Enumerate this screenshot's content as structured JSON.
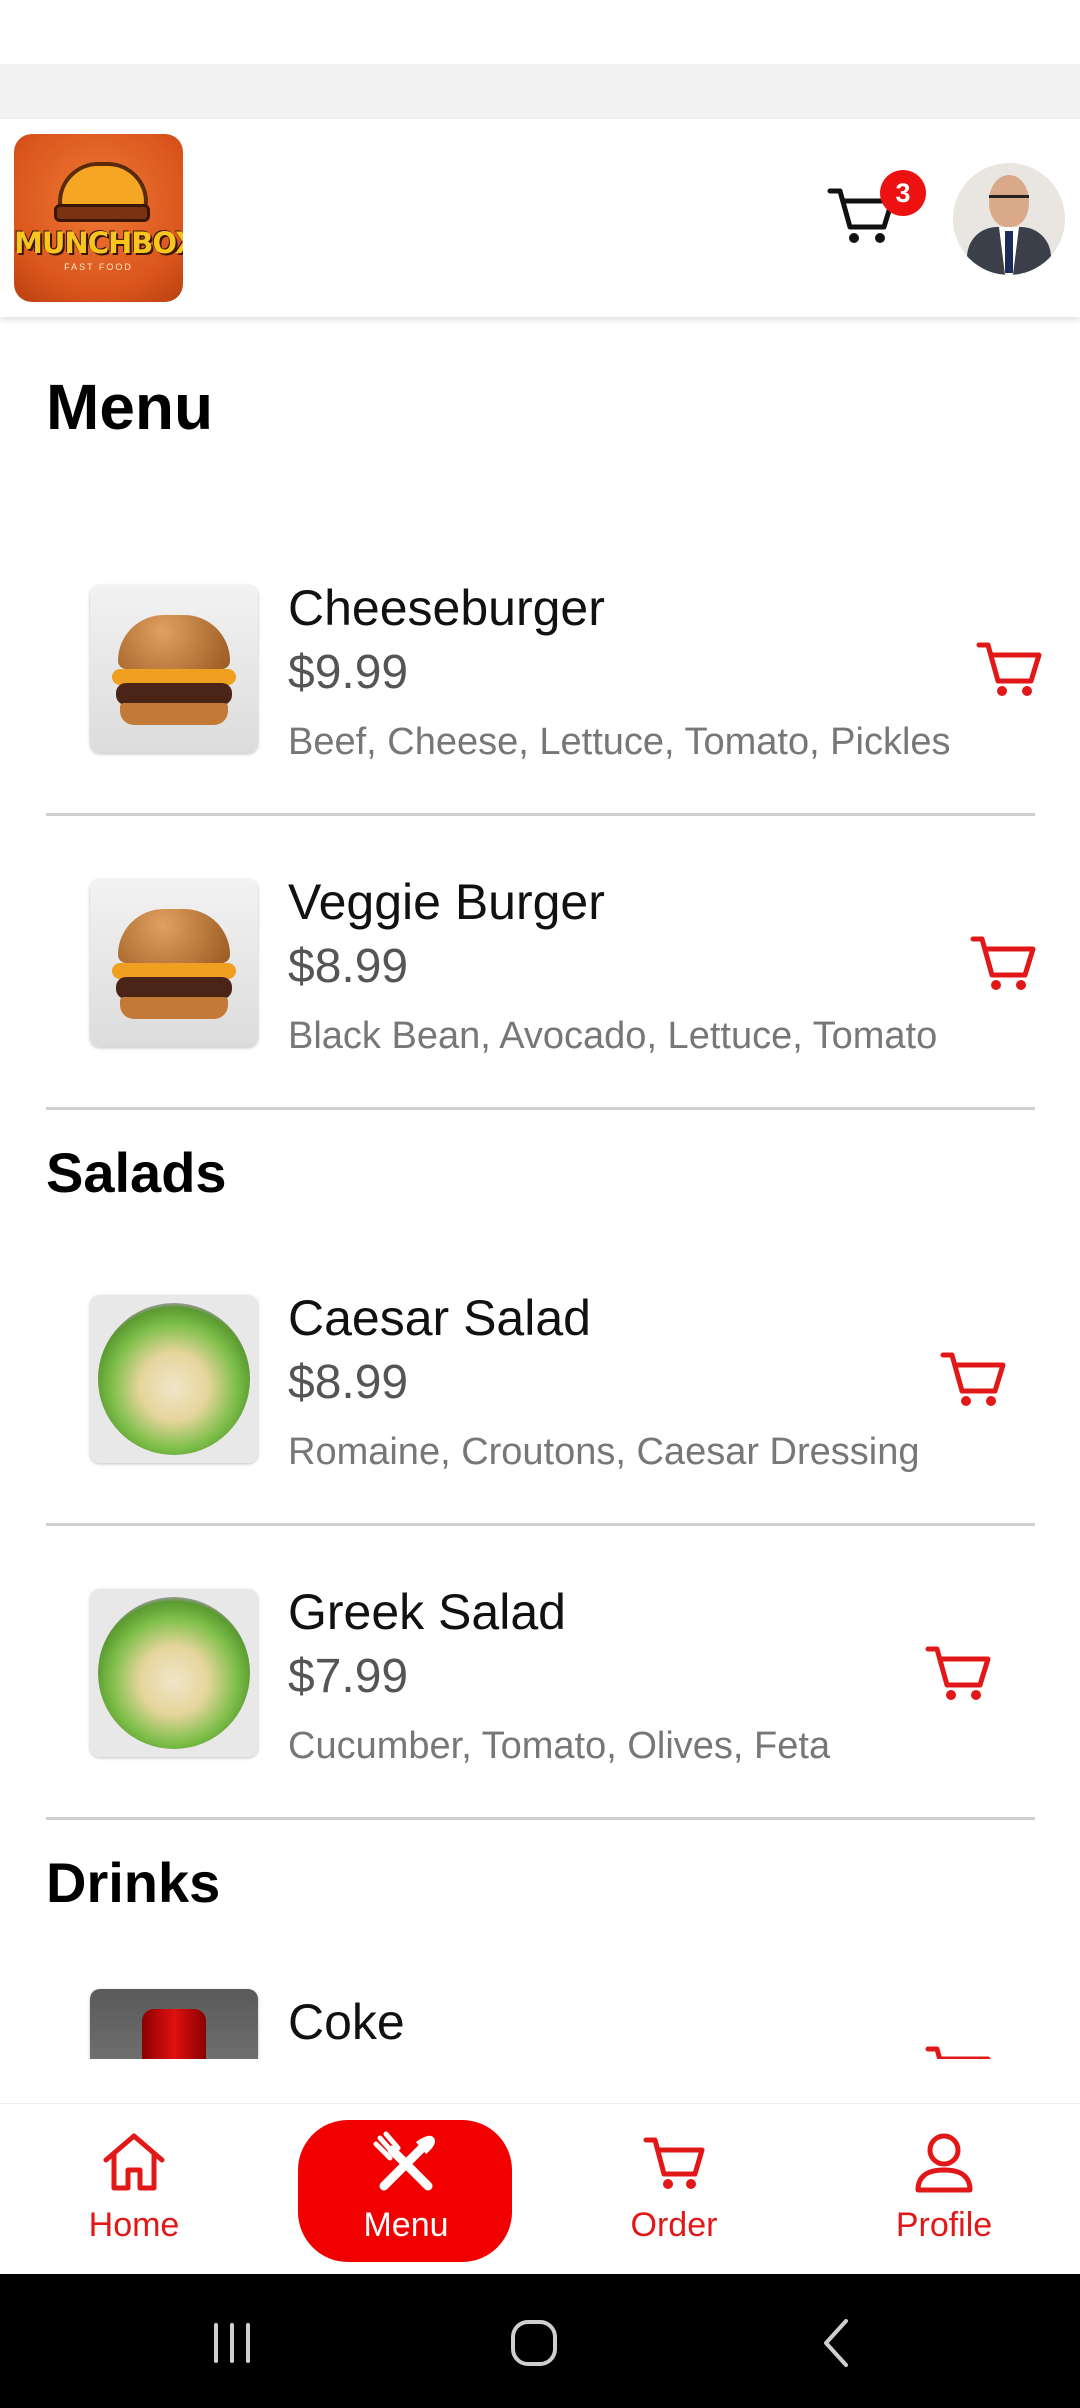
{
  "header": {
    "logo_text": "MUNCHBOX",
    "logo_subtext": "FAST FOOD",
    "cart_count": "3"
  },
  "page_title": "Menu",
  "sections": [
    {
      "title": "",
      "items": [
        {
          "name": "Cheeseburger",
          "price": "$9.99",
          "description": "Beef, Cheese, Lettuce, Tomato, Pickles",
          "image": "burger"
        },
        {
          "name": "Veggie Burger",
          "price": "$8.99",
          "description": "Black Bean, Avocado, Lettuce, Tomato",
          "image": "burger"
        }
      ]
    },
    {
      "title": "Salads",
      "items": [
        {
          "name": "Caesar Salad",
          "price": "$8.99",
          "description": "Romaine, Croutons, Caesar Dressing",
          "image": "salad"
        },
        {
          "name": "Greek Salad",
          "price": "$7.99",
          "description": "Cucumber, Tomato, Olives, Feta",
          "image": "salad"
        }
      ]
    },
    {
      "title": "Drinks",
      "items": [
        {
          "name": "Coke",
          "price": "",
          "description": "",
          "image": "coke"
        }
      ]
    }
  ],
  "bottom_nav": {
    "items": [
      {
        "label": "Home",
        "icon": "home-icon",
        "active": false
      },
      {
        "label": "Menu",
        "icon": "utensils-icon",
        "active": true
      },
      {
        "label": "Order",
        "icon": "cart-icon",
        "active": false
      },
      {
        "label": "Profile",
        "icon": "person-icon",
        "active": false
      }
    ]
  },
  "colors": {
    "accent": "#f20000",
    "nav_text": "#e21818",
    "price_text": "#555555",
    "description_text": "#777777"
  }
}
